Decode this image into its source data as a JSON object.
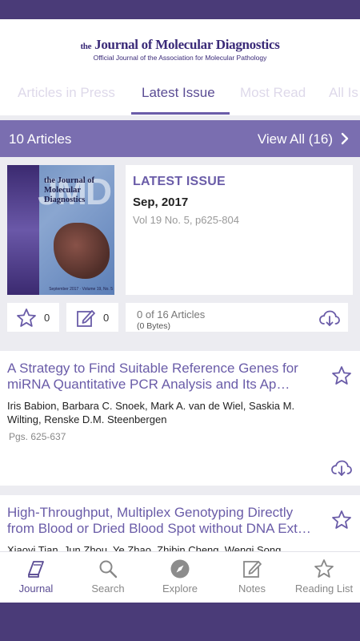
{
  "header": {
    "logo_main_small_1": "the",
    "logo_main_big": "Journal of Molecular Diagnostics",
    "logo_subtitle": "Official Journal of the Association for Molecular Pathology"
  },
  "tabs": [
    {
      "label": "Articles in Press",
      "active": false
    },
    {
      "label": "Latest Issue",
      "active": true
    },
    {
      "label": "Most Read",
      "active": false
    },
    {
      "label": "All Is",
      "active": false
    }
  ],
  "count_bar": {
    "articles_count": "10 Articles",
    "view_all": "View All (16)"
  },
  "issue": {
    "cover": {
      "title_line_1": "the Journal of",
      "title_line_2": "Molecular",
      "title_line_3": "Diagnostics",
      "big_letters": "JMD",
      "footer": "September 2017 · Volume 19, No. 5"
    },
    "label": "LATEST ISSUE",
    "date": "Sep, 2017",
    "volume": "Vol 19 No. 5, p625-804",
    "bookmark_count": "0",
    "notes_count": "0",
    "download_count": "0 of 16 Articles",
    "download_size": "(0 Bytes)"
  },
  "articles": [
    {
      "title": "A Strategy to Find Suitable Reference Genes for miRNA Quantitative PCR Analysis and Its Ap…",
      "authors": "Iris Babion, Barbara C. Snoek, Mark A. van de Wiel, Saskia M. Wilting, Renske D.M. Steenbergen",
      "pages": "Pgs. 625-637"
    },
    {
      "title": "High-Throughput, Multiplex Genotyping Directly from Blood or Dried Blood Spot without DNA Ext…",
      "authors": "Xiaoyi Tian, Jun Zhou, Ye Zhao, Zhibin Cheng, Wenqi Song"
    }
  ],
  "bottom_tabs": [
    {
      "label": "Journal",
      "icon": "journal-icon",
      "active": true
    },
    {
      "label": "Search",
      "icon": "search-icon",
      "active": false
    },
    {
      "label": "Explore",
      "icon": "compass-icon",
      "active": false
    },
    {
      "label": "Notes",
      "icon": "notes-icon",
      "active": false
    },
    {
      "label": "Reading List",
      "icon": "star-icon",
      "active": false
    }
  ],
  "colors": {
    "brand": "#4a3b78",
    "accent": "#6a5ca8",
    "bar": "#7a6eb0"
  }
}
